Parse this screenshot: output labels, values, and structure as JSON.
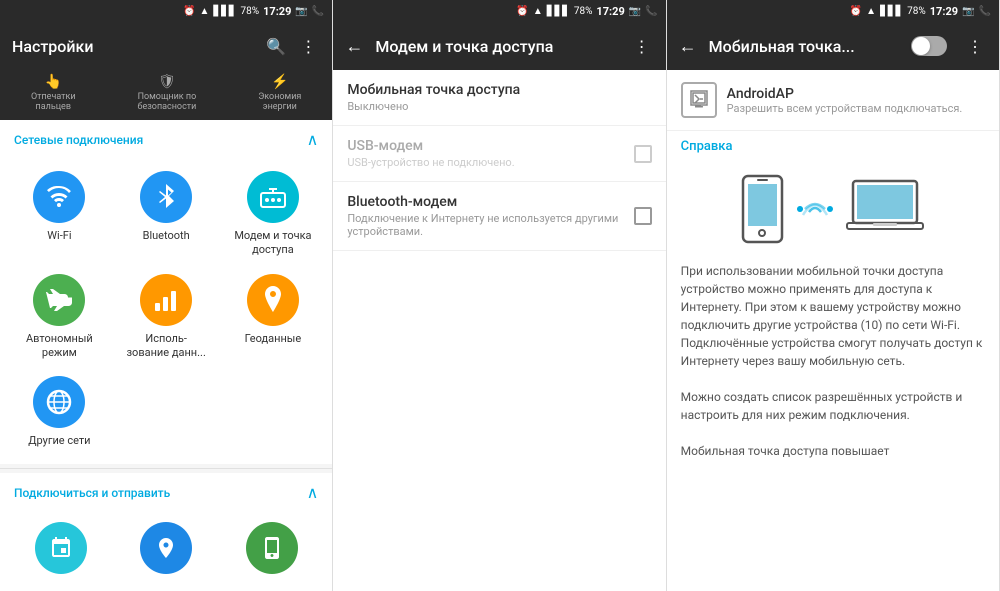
{
  "statusBar": {
    "alarm": "⏰",
    "wifi": "📶",
    "signal": "📶",
    "battery": "78%",
    "time": "17:29",
    "icons": [
      "📷",
      "📞"
    ]
  },
  "panel1": {
    "title": "Настройки",
    "shortcuts": [
      {
        "icon": "👆",
        "label": "Отпечатки\nпальцев"
      },
      {
        "icon": "🛡",
        "label": "Помощник по\nбезопасности"
      },
      {
        "icon": "⚡",
        "label": "Экономия\nэнергии"
      }
    ],
    "networkSection": {
      "label": "Сетевые подключения",
      "items": [
        {
          "icon": "wifi",
          "label": "Wi-Fi",
          "color": "blue"
        },
        {
          "icon": "bluetooth",
          "label": "Bluetooth",
          "color": "blue"
        },
        {
          "icon": "router",
          "label": "Модем и точка доступа",
          "color": "teal"
        },
        {
          "icon": "plane",
          "label": "Автономный режим",
          "color": "green"
        },
        {
          "icon": "data",
          "label": "Использование данн...",
          "color": "orange"
        },
        {
          "icon": "geo",
          "label": "Геоданные",
          "color": "orange"
        },
        {
          "icon": "network",
          "label": "Другие сети",
          "color": "blue"
        }
      ]
    },
    "connectSection": {
      "label": "Подключиться и отправить"
    }
  },
  "panel2": {
    "title": "Модем и точка доступа",
    "mobileHotspot": {
      "title": "Мобильная точка доступа",
      "status": "Выключено"
    },
    "usbModem": {
      "title": "USB-модем",
      "sub": "USB-устройство не подключено.",
      "disabled": true
    },
    "bluetoothModem": {
      "title": "Bluetooth-модем",
      "sub": "Подключение к Интернету не используется другими устройствами."
    }
  },
  "panel3": {
    "title": "Мобильная точка...",
    "toggle": "off",
    "apName": "AndroidAP",
    "apSub": "Разрешить всем устройствам подключаться.",
    "helpLabel": "Справка",
    "text1": "При использовании мобильной точки доступа устройство можно применять для доступа к Интернету. При этом к вашему устройству можно подключить другие устройства (10) по сети Wi-Fi. Подключённые устройства смогут получать доступ к Интернету через вашу мобильную сеть.",
    "text2": "Можно создать список разрешённых устройств и настроить для них режим подключения.",
    "text3": "Мобильная точка доступа повышает"
  }
}
